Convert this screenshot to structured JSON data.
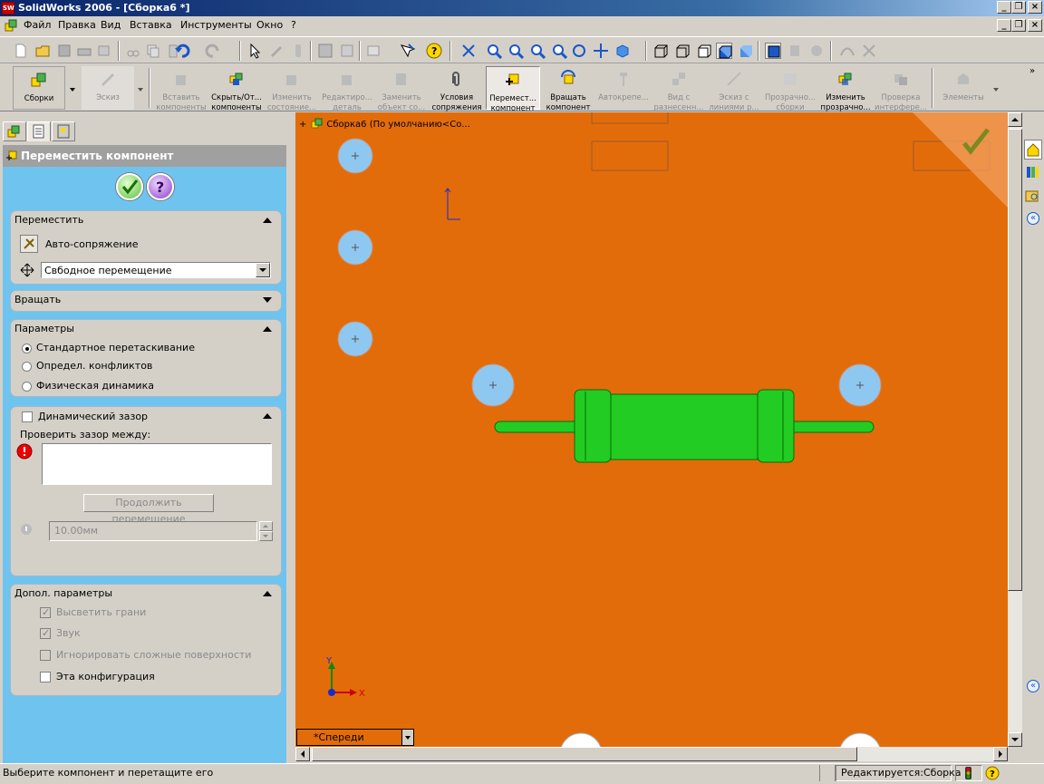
{
  "window": {
    "title": "SolidWorks 2006 - [Сборка6 *]",
    "app_icon_text": "SW"
  },
  "menu": [
    "Файл",
    "Правка",
    "Вид",
    "Вставка",
    "Инструменты",
    "Окно",
    "?"
  ],
  "command_manager": [
    {
      "line1": "Сборки",
      "line2": "",
      "enabled": true
    },
    {
      "line1": "Эскиз",
      "line2": "",
      "enabled": false
    },
    {
      "line1": "Вставить",
      "line2": "компоненты",
      "enabled": false
    },
    {
      "line1": "Скрыть/От...",
      "line2": "компоненты",
      "enabled": true
    },
    {
      "line1": "Изменить",
      "line2": "состояние...",
      "enabled": false
    },
    {
      "line1": "Редактиро...",
      "line2": "деталь",
      "enabled": false
    },
    {
      "line1": "Заменить",
      "line2": "объект со...",
      "enabled": false
    },
    {
      "line1": "Условия",
      "line2": "сопряжения",
      "enabled": true
    },
    {
      "line1": "Перемест...",
      "line2": "компонент",
      "enabled": true,
      "active": true
    },
    {
      "line1": "Вращать",
      "line2": "компонент",
      "enabled": true
    },
    {
      "line1": "Автокрепе...",
      "line2": "",
      "enabled": false
    },
    {
      "line1": "Вид с",
      "line2": "разнесенн...",
      "enabled": false
    },
    {
      "line1": "Эскиз с",
      "line2": "линиями р...",
      "enabled": false
    },
    {
      "line1": "Прозрачно...",
      "line2": "сборки",
      "enabled": false
    },
    {
      "line1": "Изменить",
      "line2": "прозрачно...",
      "enabled": true
    },
    {
      "line1": "Проверка",
      "line2": "интерфере...",
      "enabled": false
    },
    {
      "line1": "Элементы",
      "line2": "",
      "enabled": false
    }
  ],
  "property_manager": {
    "title": "Переместить компонент",
    "move_group": {
      "title": "Переместить",
      "smartmates_label": "Авто-сопряжение",
      "move_mode_value": "Свбодное перемещение"
    },
    "rotate_group": {
      "title": "Вращать"
    },
    "options_group": {
      "title": "Параметры",
      "options": [
        {
          "label": "Стандартное перетаскивание",
          "selected": true
        },
        {
          "label": "Определ. конфликтов",
          "selected": false
        },
        {
          "label": "Физическая динамика",
          "selected": false
        }
      ]
    },
    "clearance_group": {
      "title": "Динамический зазор",
      "check_between_label": "Проверить зазор между:",
      "resume_button": "Продолжить перемещение",
      "distance_value": "10.00мм"
    },
    "advanced_group": {
      "title": "Допол. параметры",
      "options": [
        {
          "label": "Высветить грани",
          "checked": true,
          "enabled": false
        },
        {
          "label": "Звук",
          "checked": true,
          "enabled": false
        },
        {
          "label": "Игнорировать сложные поверхности",
          "checked": false,
          "enabled": false
        },
        {
          "label": "Эта конфигурация",
          "checked": false,
          "enabled": true
        }
      ]
    }
  },
  "viewport": {
    "tree_root_label": "Сборка6  (По умолчанию<Со...",
    "view_selector": "*Спереди",
    "axis_y": "Y",
    "axis_x": "X",
    "background_color": "#e36c0a",
    "component_color": "#22cc22",
    "hole_color": "#8ec8f0"
  },
  "status": {
    "hint": "Выберите компонент и перетащите его",
    "mode": "Редактируется:Сборка"
  }
}
